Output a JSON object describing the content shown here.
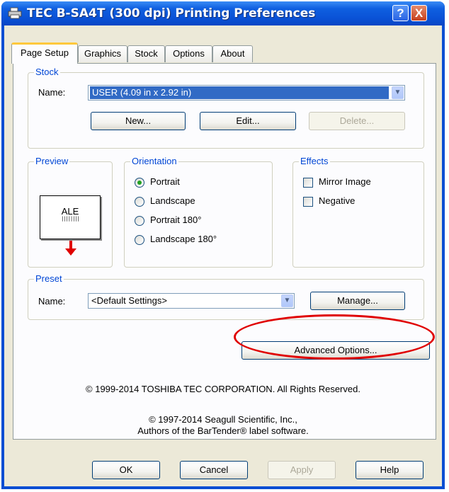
{
  "window": {
    "title": "TEC B-SA4T (300 dpi) Printing Preferences",
    "help_button": "?",
    "close_button": "X"
  },
  "tabs": [
    {
      "label": "Page Setup"
    },
    {
      "label": "Graphics"
    },
    {
      "label": "Stock"
    },
    {
      "label": "Options"
    },
    {
      "label": "About"
    }
  ],
  "stock": {
    "legend": "Stock",
    "name_label": "Name:",
    "name_value": "USER (4.09 in x 2.92 in)",
    "new_button": "New...",
    "edit_button": "Edit...",
    "delete_button": "Delete..."
  },
  "preview": {
    "legend": "Preview",
    "sample_text": "ALE",
    "barcode": "||||||||"
  },
  "orientation": {
    "legend": "Orientation",
    "options": [
      "Portrait",
      "Landscape",
      "Portrait 180°",
      "Landscape 180°"
    ],
    "selected": "Portrait"
  },
  "effects": {
    "legend": "Effects",
    "mirror_image": "Mirror Image",
    "negative": "Negative"
  },
  "preset": {
    "legend": "Preset",
    "name_label": "Name:",
    "name_value": "<Default Settings>",
    "manage_button": "Manage..."
  },
  "advanced_button": "Advanced Options...",
  "copyright": {
    "line1": "© 1999-2014 TOSHIBA TEC CORPORATION.  All Rights Reserved.",
    "line2": "© 1997-2014 Seagull Scientific, Inc.,",
    "line3": "Authors of the BarTender® label software."
  },
  "footer": {
    "ok": "OK",
    "cancel": "Cancel",
    "apply": "Apply",
    "help": "Help"
  },
  "colors": {
    "accent_blue": "#0046d5",
    "highlight": "#e00000",
    "selection": "#316ac5"
  }
}
